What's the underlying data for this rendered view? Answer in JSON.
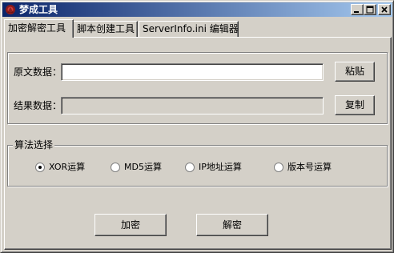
{
  "window": {
    "title": "梦成工具"
  },
  "tabs": [
    {
      "label": "加密解密工具",
      "active": true
    },
    {
      "label": "脚本创建工具",
      "active": false
    },
    {
      "label": "ServerInfo.ini 编辑器",
      "active": false
    }
  ],
  "data_group": {
    "source_label": "原文数据：",
    "source_value": "",
    "result_label": "结果数据：",
    "result_value": "",
    "paste_button": "粘贴",
    "copy_button": "复制"
  },
  "algorithm_group": {
    "title": "算法选择",
    "options": [
      {
        "label": "XOR运算",
        "selected": true
      },
      {
        "label": "MD5运算",
        "selected": false
      },
      {
        "label": "IP地址运算",
        "selected": false
      },
      {
        "label": "版本号运算",
        "selected": false
      }
    ]
  },
  "actions": {
    "encrypt_button": "加密",
    "decrypt_button": "解密"
  },
  "colors": {
    "face": "#d4d0c8",
    "titlebar_start": "#0a246a",
    "titlebar_end": "#a6caf0"
  }
}
